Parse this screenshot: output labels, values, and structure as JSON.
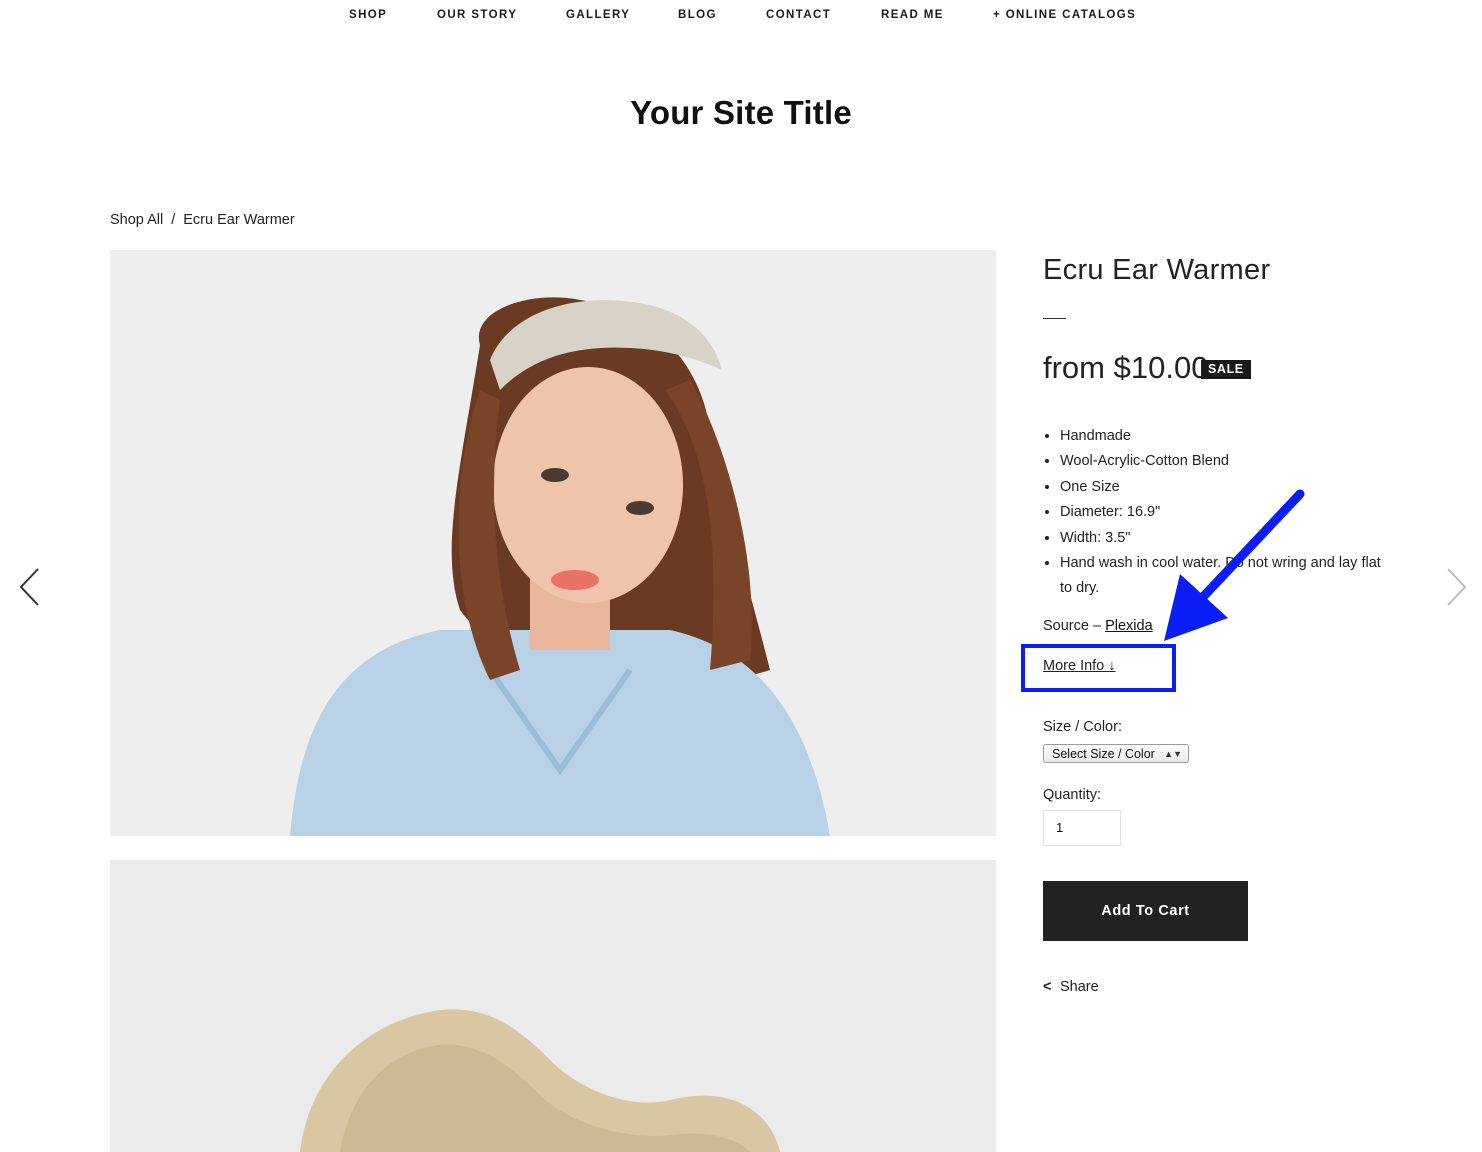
{
  "nav": {
    "items": [
      "SHOP",
      "OUR STORY",
      "GALLERY",
      "BLOG",
      "CONTACT",
      "READ ME",
      "+ ONLINE CATALOGS"
    ]
  },
  "site_title": "Your Site Title",
  "breadcrumb": {
    "root": "Shop All",
    "separator": "/",
    "current": "Ecru Ear Warmer"
  },
  "product": {
    "title": "Ecru Ear Warmer",
    "price": "from $10.00",
    "badge": "SALE",
    "features": [
      "Handmade",
      "Wool-Acrylic-Cotton Blend",
      "One Size",
      "Diameter: 16.9\"",
      "Width: 3.5\"",
      "Hand wash in cool water. Do not wring and lay flat to dry."
    ],
    "source_label": "Source –",
    "source_link": "Plexida",
    "more_info": "More Info ↓",
    "size_label": "Size / Color:",
    "size_select_value": "Select Size / Color",
    "quantity_label": "Quantity:",
    "quantity_value": "1",
    "add_to_cart": "Add To Cart",
    "share": "Share"
  },
  "icons": {
    "prev": "chevron-left-icon",
    "next": "chevron-right-icon",
    "share": "share-icon",
    "annotation_arrow": "arrow-annotation-icon"
  },
  "colors": {
    "button_bg": "#222222",
    "badge_bg": "#1a1a1a",
    "annotation_blue": "#0a1ef5",
    "image_bg": "#ececec"
  }
}
